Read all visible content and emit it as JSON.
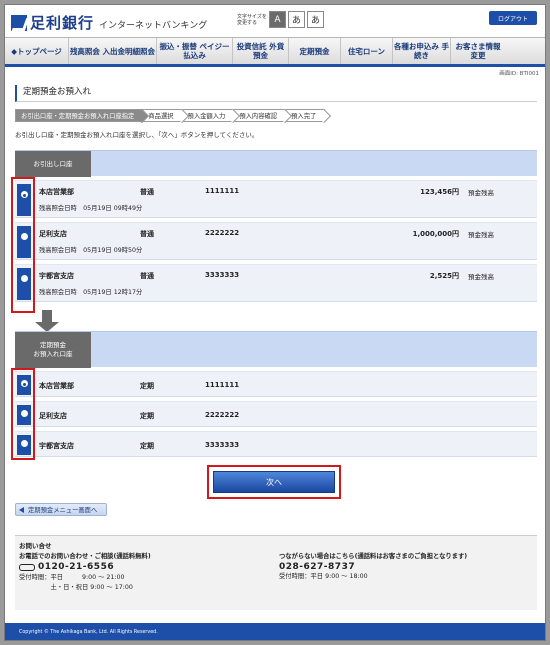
{
  "header": {
    "logo_text": "足利銀行",
    "logo_sub": "インターネットバンキング",
    "font_size_label": "文字サイズを変更する",
    "font_sizes": [
      "A",
      "あ",
      "あ"
    ],
    "logout_label": "ログアウト"
  },
  "nav": {
    "items": [
      {
        "label": "◆トップページ"
      },
      {
        "label": "残高照会 入出金明細照会"
      },
      {
        "label": "振込・振替 ペイジー払込み"
      },
      {
        "label": "投資信託 外貨預金"
      },
      {
        "label": "定期預金"
      },
      {
        "label": "住宅ローン"
      },
      {
        "label": "各種お申込み 手続き"
      },
      {
        "label": "お客さま情報 変更"
      }
    ]
  },
  "screen_id": "画面ID: BTI001",
  "page_title": "定期預金お預入れ",
  "steps": [
    "お引出口座・定期預金お預入れ口座指定",
    "商品選択",
    "預入金額入力",
    "預入内容確認",
    "預入完了"
  ],
  "instruction": "お引出し口座・定期預金お預入れ口座を選択し、「次へ」ボタンを押してください。",
  "withdrawal_section": {
    "tag": "お引出し口座",
    "accounts": [
      {
        "branch": "本店営業部",
        "type": "普通",
        "number": "1111111",
        "amount": "123,456円",
        "amount_label": "預金残高",
        "updated": "残高照会日時　05月19日 09時49分",
        "selected": true
      },
      {
        "branch": "足利支店",
        "type": "普通",
        "number": "2222222",
        "amount": "1,000,000円",
        "amount_label": "預金残高",
        "updated": "残高照会日時　05月19日 09時50分",
        "selected": false
      },
      {
        "branch": "宇都宮支店",
        "type": "普通",
        "number": "3333333",
        "amount": "2,525円",
        "amount_label": "預金残高",
        "updated": "残高照会日時　05月19日 12時17分",
        "selected": false
      }
    ]
  },
  "deposit_section": {
    "tag_line1": "定期預金",
    "tag_line2": "お預入れ口座",
    "accounts": [
      {
        "branch": "本店営業部",
        "type": "定期",
        "number": "1111111",
        "selected": true
      },
      {
        "branch": "足利支店",
        "type": "定期",
        "number": "2222222",
        "selected": false
      },
      {
        "branch": "宇都宮支店",
        "type": "定期",
        "number": "3333333",
        "selected": false
      }
    ]
  },
  "next_button": "次へ",
  "back_link": "定期預金メニュー画面へ",
  "contact": {
    "title": "お問い合せ",
    "left_heading": "お電話でのお問い合わせ・ご相談(通話料無料)",
    "left_tel": "0120-21-6556",
    "left_hours1": "受付時間：平日　　　9:00 ～ 21:00",
    "left_hours2": "　　　　　土・日・祝日 9:00 ～ 17:00",
    "right_heading": "つながらない場合はこちら(通話料はお客さまのご負担となります)",
    "right_tel": "028-627-8737",
    "right_hours": "受付時間：平日 9:00 ～ 18:00"
  },
  "footer": "Copyright © The Ashikaga Bank, Ltd. All Rights Reserved."
}
